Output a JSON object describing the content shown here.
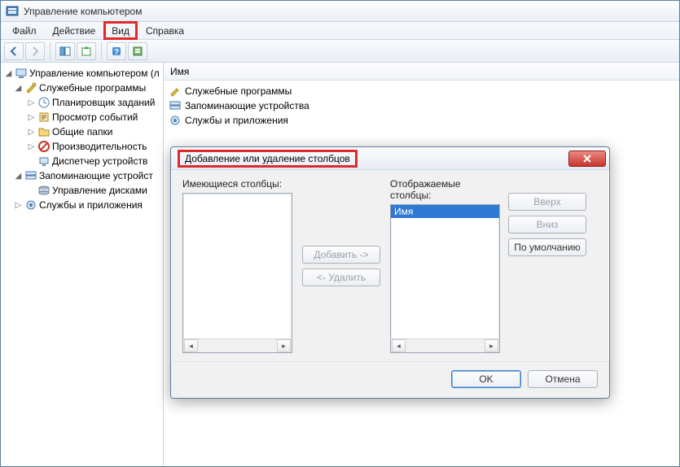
{
  "window": {
    "title": "Управление компьютером"
  },
  "menu": {
    "file": "Файл",
    "action": "Действие",
    "view": "Вид",
    "help": "Справка"
  },
  "tree": {
    "root": "Управление компьютером (л",
    "system_tools": "Служебные программы",
    "task_scheduler": "Планировщик заданий",
    "event_viewer": "Просмотр событий",
    "shared_folders": "Общие папки",
    "performance": "Производительность",
    "device_manager": "Диспетчер устройств",
    "storage": "Запоминающие устройст",
    "disk_mgmt": "Управление дисками",
    "services_apps": "Службы и приложения"
  },
  "content": {
    "header": "Имя",
    "items": {
      "system_tools": "Служебные программы",
      "storage": "Запоминающие устройства",
      "services_apps": "Службы и приложения"
    }
  },
  "dialog": {
    "title": "Добавление или удаление столбцов",
    "available_label": "Имеющиеся столбцы:",
    "displayed_label": "Отображаемые столбцы:",
    "displayed_item": "Имя",
    "add": "Добавить ->",
    "remove": "<- Удалить",
    "up": "Вверх",
    "down": "Вниз",
    "defaults": "По умолчанию",
    "ok": "OK",
    "cancel": "Отмена"
  }
}
